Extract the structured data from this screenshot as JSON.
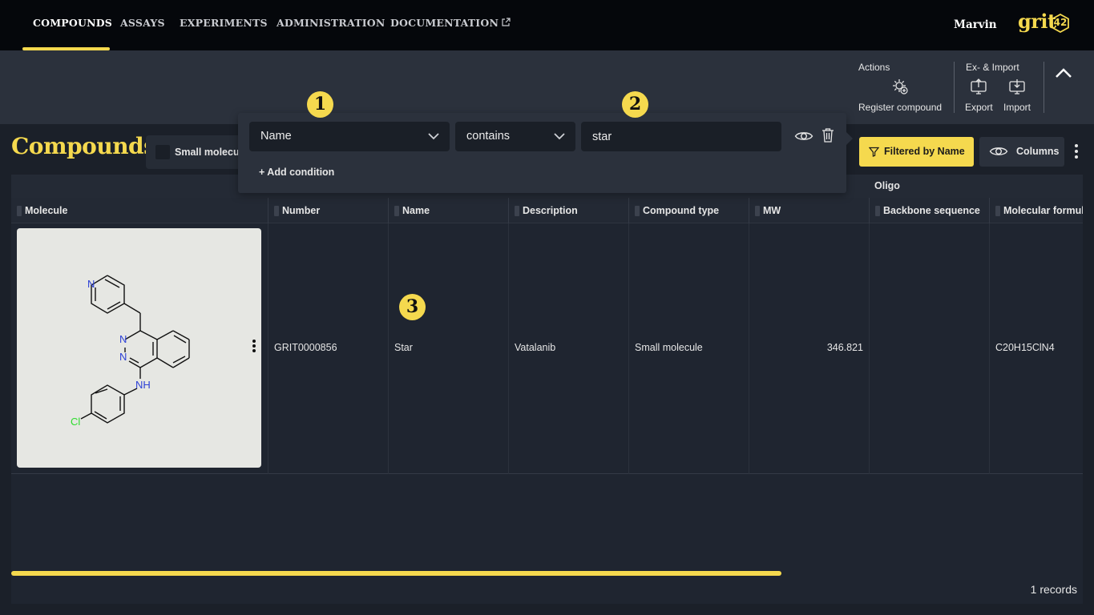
{
  "nav": {
    "items": [
      "COMPOUNDS",
      "ASSAYS",
      "EXPERIMENTS",
      "ADMINISTRATION",
      "DOCUMENTATION"
    ],
    "active": "COMPOUNDS",
    "user": "Marvin",
    "logo_text": "grit",
    "logo_badge": "42"
  },
  "actionbar": {
    "actions_title": "Actions",
    "register_label": "Register compound",
    "io_title": "Ex- & Import",
    "export_label": "Export",
    "import_label": "Import"
  },
  "page": {
    "title": "Compounds",
    "type_filter_label": "Small molecu",
    "filtered_button": "Filtered by Name",
    "columns_button": "Columns"
  },
  "filter": {
    "field": "Name",
    "operator": "contains",
    "value": "star",
    "add_condition": "+ Add condition"
  },
  "grid": {
    "group_label": "Oligo",
    "columns": [
      "Molecule",
      "Number",
      "Name",
      "Description",
      "Compound type",
      "MW",
      "Backbone sequence",
      "Molecular formul"
    ],
    "rows": [
      {
        "number": "GRIT0000856",
        "name": "Star",
        "description": "Vatalanib",
        "compound_type": "Small molecule",
        "mw": "346.821",
        "backbone": "",
        "formula": "C20H15ClN4"
      }
    ],
    "records": "1 records"
  },
  "molecule": {
    "atoms": [
      "N",
      "N",
      "N",
      "NH",
      "Cl"
    ]
  },
  "markers": [
    "1",
    "2",
    "3"
  ],
  "colors": {
    "accent": "#f5d94e",
    "nitrogen": "#2b3fd6",
    "chlorine": "#2ddc2d"
  }
}
